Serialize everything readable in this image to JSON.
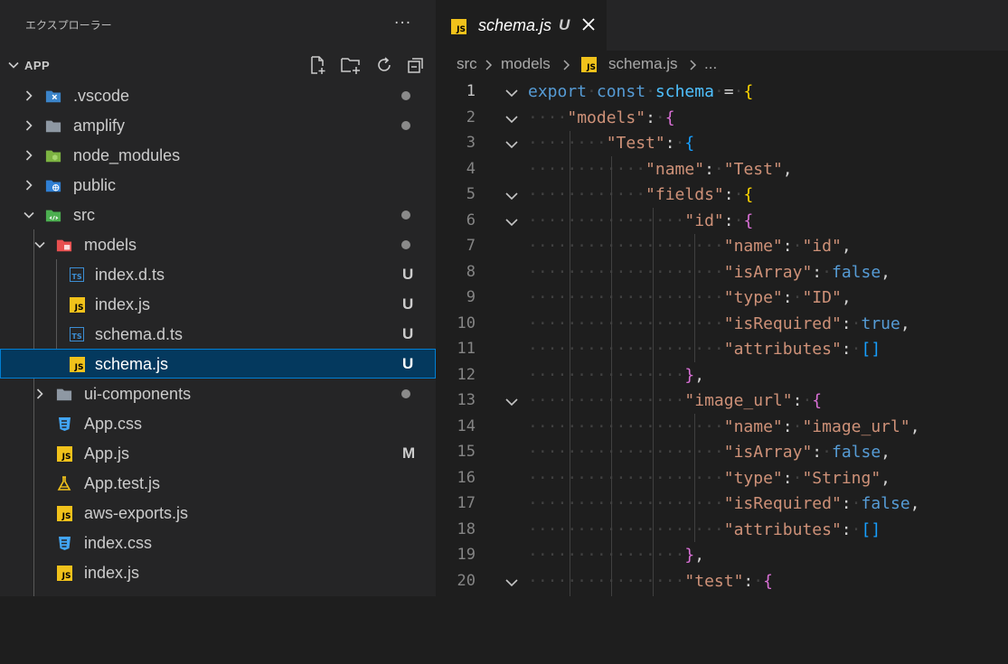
{
  "explorer": {
    "title": "エクスプローラー",
    "more": "···",
    "section_title": "APP",
    "items": [
      {
        "label": ".vscode",
        "status": "dot"
      },
      {
        "label": "amplify",
        "status": "dot"
      },
      {
        "label": "node_modules",
        "status": ""
      },
      {
        "label": "public",
        "status": ""
      },
      {
        "label": "src",
        "status": "dot"
      },
      {
        "label": "models",
        "status": "dot"
      },
      {
        "label": "index.d.ts",
        "status": "U",
        "icon": "TS"
      },
      {
        "label": "index.js",
        "status": "U",
        "icon": "JS"
      },
      {
        "label": "schema.d.ts",
        "status": "U",
        "icon": "TS"
      },
      {
        "label": "schema.js",
        "status": "U",
        "icon": "JS"
      },
      {
        "label": "ui-components",
        "status": "dot"
      },
      {
        "label": "App.css",
        "status": ""
      },
      {
        "label": "App.js",
        "status": "M",
        "icon": "JS"
      },
      {
        "label": "App.test.js",
        "status": ""
      },
      {
        "label": "aws-exports.js",
        "status": "",
        "icon": "JS"
      },
      {
        "label": "index.css",
        "status": ""
      },
      {
        "label": "index.js",
        "status": "",
        "icon": "JS"
      }
    ]
  },
  "tab": {
    "label": "schema.js",
    "status": "U",
    "icon": "JS"
  },
  "breadcrumb": [
    "src",
    "models",
    "schema.js",
    "..."
  ],
  "breadcrumb_icon": "JS",
  "code": {
    "line_numbers": [
      "1",
      "2",
      "3",
      "4",
      "5",
      "6",
      "7",
      "8",
      "9",
      "10",
      "11",
      "12",
      "13",
      "14",
      "15",
      "16",
      "17",
      "18",
      "19",
      "20"
    ],
    "lines": [
      [
        "export",
        "const",
        "schema",
        "=",
        "{"
      ],
      [
        "\"models\"",
        ":",
        "{"
      ],
      [
        "\"Test\"",
        ":",
        "{"
      ],
      [
        "\"name\"",
        ":",
        "\"Test\"",
        ","
      ],
      [
        "\"fields\"",
        ":",
        "{"
      ],
      [
        "\"id\"",
        ":",
        "{"
      ],
      [
        "\"name\"",
        ":",
        "\"id\"",
        ","
      ],
      [
        "\"isArray\"",
        ":",
        "false",
        ","
      ],
      [
        "\"type\"",
        ":",
        "\"ID\"",
        ","
      ],
      [
        "\"isRequired\"",
        ":",
        "true",
        ","
      ],
      [
        "\"attributes\"",
        ":",
        "[]"
      ],
      [
        "}",
        ","
      ],
      [
        "\"image_url\"",
        ":",
        "{"
      ],
      [
        "\"name\"",
        ":",
        "\"image_url\"",
        ","
      ],
      [
        "\"isArray\"",
        ":",
        "false",
        ","
      ],
      [
        "\"type\"",
        ":",
        "\"String\"",
        ","
      ],
      [
        "\"isRequired\"",
        ":",
        "false",
        ","
      ],
      [
        "\"attributes\"",
        ":",
        "[]"
      ],
      [
        "}",
        ","
      ],
      [
        "\"test\"",
        ":",
        "{"
      ]
    ]
  },
  "colors": {
    "selection": "#04395e",
    "js_icon": "#f1c21b",
    "ts_icon": "#3c8ed4",
    "keyword": "#569cd6",
    "string": "#ce9178",
    "variable": "#4fc1ff",
    "bracket_1": "#ffd700",
    "bracket_2": "#da70d6",
    "bracket_3": "#179fff"
  }
}
